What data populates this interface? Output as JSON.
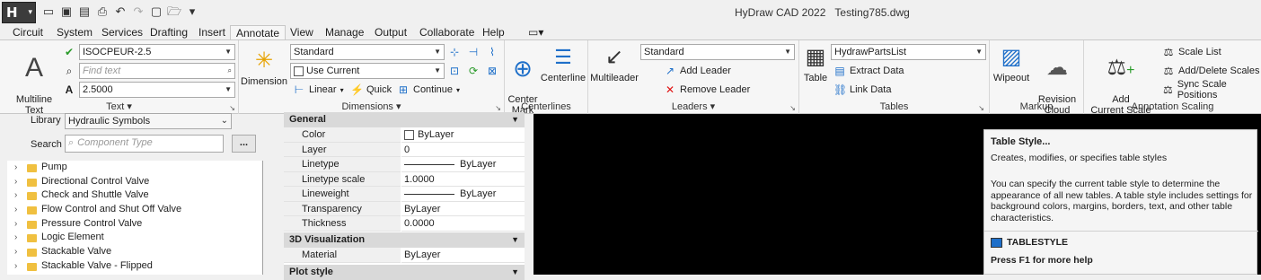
{
  "app": {
    "logo": "H",
    "title": "HyDraw CAD 2022",
    "document": "Testing785.dwg"
  },
  "quick_access": [
    "new-icon",
    "save-icon",
    "save-as-icon",
    "print-icon",
    "undo-icon",
    "redo-icon",
    "new-file-icon",
    "open-icon",
    "customize-icon"
  ],
  "tabs": [
    "Circuit",
    "System",
    "Services",
    "Drafting",
    "Insert",
    "Annotate",
    "View",
    "Manage",
    "Output",
    "Collaborate",
    "Help"
  ],
  "active_tab": "Annotate",
  "ribbon": {
    "text": {
      "multiline_label": "Multiline\nText",
      "style_value": "ISOCPEUR-2.5",
      "find_placeholder": "Find text",
      "height_value": "2.5000",
      "title": "Text"
    },
    "dimensions": {
      "dimension_label": "Dimension",
      "style_value": "Standard",
      "layer_value": "Use Current",
      "linear_label": "Linear",
      "quick_label": "Quick",
      "continue_label": "Continue",
      "title": "Dimensions"
    },
    "centerlines": {
      "center_mark_label": "Center\nMark",
      "centerline_label": "Centerline",
      "title": "Centerlines"
    },
    "leaders": {
      "multileader_label": "Multileader",
      "style_value": "Standard",
      "add_label": "Add Leader",
      "remove_label": "Remove Leader",
      "title": "Leaders"
    },
    "tables": {
      "table_label": "Table",
      "style_value": "HydrawPartsList",
      "extract_label": "Extract Data",
      "link_label": "Link Data",
      "title": "Tables"
    },
    "markup": {
      "wipeout_label": "Wipeout",
      "revision_label": "Revision\nCloud",
      "title": "Markup"
    },
    "scaling": {
      "add_scale_label": "Add\nCurrent Scale",
      "scale_list_label": "Scale List",
      "add_delete_label": "Add/Delete Scales",
      "sync_label": "Sync Scale Positions",
      "title": "Annotation Scaling"
    }
  },
  "library": {
    "label": "Library",
    "value": "Hydraulic Symbols",
    "search_label": "Search",
    "search_placeholder": "Component Type",
    "more_button": "...",
    "items": [
      "Pump",
      "Directional Control Valve",
      "Check and Shuttle Valve",
      "Flow Control and Shut Off Valve",
      "Pressure Control Valve",
      "Logic Element",
      "Stackable Valve",
      "Stackable Valve - Flipped"
    ]
  },
  "properties": {
    "general_header": "General",
    "general_rows": [
      {
        "k": "Color",
        "v": "ByLayer"
      },
      {
        "k": "Layer",
        "v": "0"
      },
      {
        "k": "Linetype",
        "v": "ByLayer"
      },
      {
        "k": "Linetype scale",
        "v": "1.0000"
      },
      {
        "k": "Lineweight",
        "v": "ByLayer"
      },
      {
        "k": "Transparency",
        "v": "ByLayer"
      },
      {
        "k": "Thickness",
        "v": "0.0000"
      }
    ],
    "viz_header": "3D Visualization",
    "viz_rows": [
      {
        "k": "Material",
        "v": "ByLayer"
      }
    ],
    "plot_header": "Plot style"
  },
  "tooltip": {
    "title": "Table Style...",
    "short": "Creates, modifies, or specifies table styles",
    "long": "You can specify the current table style to determine the appearance of all new tables. A table style includes settings for background colors, margins, borders, text, and other table characteristics.",
    "command": "TABLESTYLE",
    "help": "Press F1 for more help"
  },
  "colors": {
    "accent": "#1e6fc9",
    "highlight": "#e01010",
    "canvas": "#000000"
  }
}
